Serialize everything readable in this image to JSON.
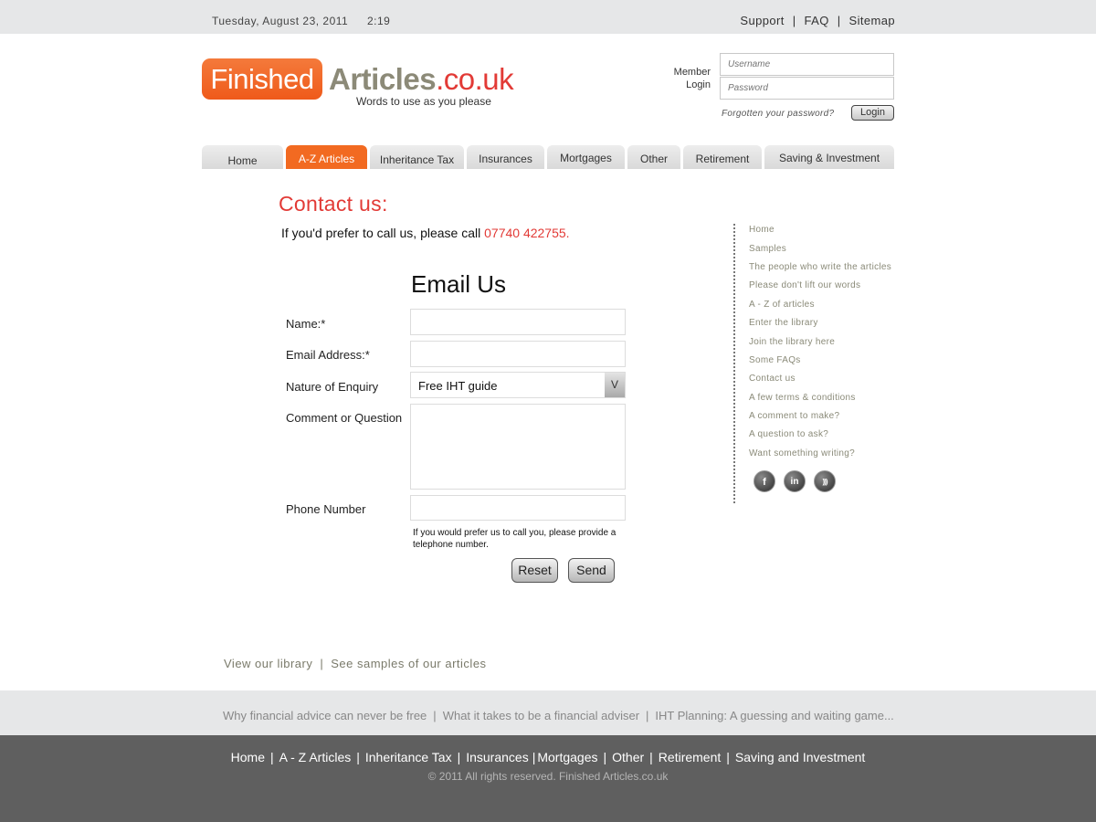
{
  "topbar": {
    "date": "Tuesday, August 23, 2011",
    "time": "2:19",
    "links": [
      "Support",
      "FAQ",
      "Sitemap"
    ]
  },
  "logo": {
    "finished": "Finished",
    "articles": "Articles",
    "domain": ".co.uk",
    "tagline": "Words to use as you please",
    "colors": {
      "orange": "#f26a21",
      "olive": "#8c8a78",
      "red": "#e23a36"
    }
  },
  "login": {
    "label_line1": "Member",
    "label_line2": "Login",
    "username_placeholder": "Username",
    "password_placeholder": "Password",
    "forgot": "Forgotten your password?",
    "button": "Login"
  },
  "nav": {
    "tabs": [
      "Home",
      "A-Z Articles",
      "Inheritance Tax",
      "Insurances",
      "Mortgages",
      "Other",
      "Retirement",
      "Saving & Investment"
    ],
    "active": "A-Z Articles"
  },
  "main": {
    "title": "Contact us:",
    "call_text": "If you'd prefer to call us, please call ",
    "phone": "07740 422755."
  },
  "form": {
    "heading": "Email Us",
    "name_label": "Name:*",
    "email_label": "Email Address:*",
    "enquiry_label": "Nature of Enquiry",
    "enquiry_value": "Free IHT guide",
    "enquiry_arrow": "V",
    "comment_label": "Comment or Question",
    "phone_label": "Phone Number",
    "phone_hint": "If you would prefer us to call you, please provide a telephone number.",
    "reset": "Reset",
    "send": "Send"
  },
  "sidebar": {
    "items": [
      "Home",
      "Samples",
      "The people who write the articles",
      "Please don't lift our words",
      "A - Z of articles",
      "Enter the library",
      "Join the library here",
      "Some FAQs",
      "Contact us",
      "A few terms & conditions",
      "A comment to make?",
      "A question to ask?",
      "Want something writing?"
    ],
    "social": [
      {
        "icon": "facebook-icon",
        "glyph": "f"
      },
      {
        "icon": "linkedin-icon",
        "glyph": "in"
      },
      {
        "icon": "rss-icon",
        "glyph": ")))"
      }
    ]
  },
  "bottom": {
    "library": "View our library",
    "samples": "See samples of our articles"
  },
  "articles_bar": {
    "items": [
      "Why financial advice can never be free",
      "What it takes to be a financial adviser",
      "IHT Planning: A guessing and waiting game..."
    ]
  },
  "footer": {
    "links": [
      "Home",
      "A - Z Articles",
      "Inheritance Tax",
      "Insurances",
      "Mortgages",
      "Other",
      "Retirement",
      "Saving and Investment"
    ],
    "copyright": "© 2011  All rights reserved.  Finished Articles.co.uk"
  }
}
